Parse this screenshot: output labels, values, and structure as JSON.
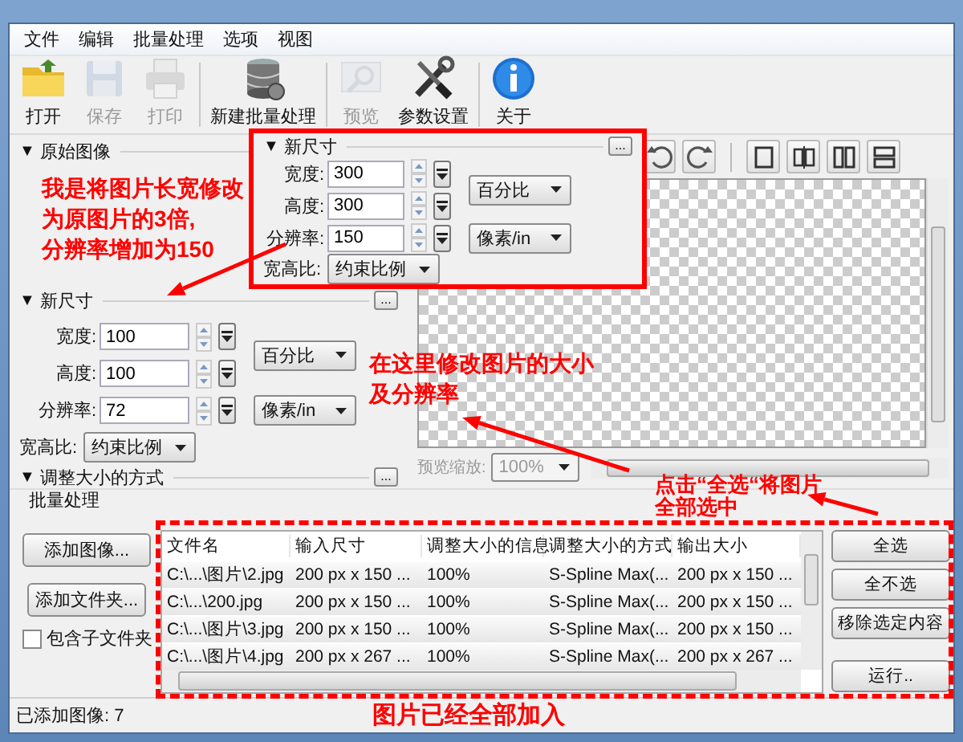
{
  "menu": [
    {
      "label": "文件"
    },
    {
      "label": "编辑"
    },
    {
      "label": "批量处理"
    },
    {
      "label": "选项"
    },
    {
      "label": "视图"
    }
  ],
  "toolbar": [
    {
      "label": "打开",
      "disabled": false
    },
    {
      "label": "保存",
      "disabled": true
    },
    {
      "label": "打印",
      "disabled": true
    },
    {
      "label": "新建批量处理",
      "disabled": false
    },
    {
      "label": "预览",
      "disabled": true
    },
    {
      "label": "参数设置",
      "disabled": false
    },
    {
      "label": "关于",
      "disabled": false
    }
  ],
  "original_image": {
    "toggle": "▼",
    "title": "原始图像"
  },
  "new_size": {
    "toggle": "▼",
    "title": "新尺寸",
    "more": "...",
    "width": {
      "label": "宽度:",
      "value": "100"
    },
    "height": {
      "label": "高度:",
      "value": "100"
    },
    "resolution": {
      "label": "分辨率:",
      "value": "72"
    },
    "size_unit": "百分比",
    "res_unit": "像素/in",
    "aspect": {
      "label": "宽高比:",
      "value": "约束比例"
    }
  },
  "resize_method": {
    "toggle": "▼",
    "title": "调整大小的方式",
    "more": "..."
  },
  "preview": {
    "zoom_label": "预览缩放:",
    "zoom_value": "100%",
    "zoom_disabled": true
  },
  "batch": {
    "title": "批量处理",
    "add_buttons": [
      "添加图像...",
      "添加文件夹..."
    ],
    "include_subfolders": {
      "label": "包含子文件夹",
      "checked": false
    },
    "table": {
      "columns": [
        "文件名",
        "输入尺寸",
        "调整大小的信息",
        "调整大小的方式",
        "输出大小"
      ],
      "rows": [
        [
          "C:\\...\\图片\\2.jpg",
          "200 px x 150 ...",
          "100%",
          "S-Spline Max(...",
          "200 px x 150 ..."
        ],
        [
          "C:\\...\\200.jpg",
          "200 px x 150 ...",
          "100%",
          "S-Spline Max(...",
          "200 px x 150 ..."
        ],
        [
          "C:\\...\\图片\\3.jpg",
          "200 px x 150 ...",
          "100%",
          "S-Spline Max(...",
          "200 px x 150 ..."
        ],
        [
          "C:\\...\\图片\\4.jpg",
          "200 px x 267 ...",
          "100%",
          "S-Spline Max(...",
          "200 px x 267 ..."
        ]
      ]
    },
    "action_buttons": [
      "全选",
      "全不选",
      "移除选定内容",
      "运行.."
    ]
  },
  "status_bar": "已添加图像: 7",
  "annotations": {
    "inset": {
      "toggle": "▼",
      "title": "新尺寸",
      "more": "...",
      "width": {
        "label": "宽度:",
        "value": "300"
      },
      "height": {
        "label": "高度:",
        "value": "300"
      },
      "resolution": {
        "label": "分辨率:",
        "value": "150"
      },
      "size_unit": "百分比",
      "res_unit": "像素/in",
      "aspect": {
        "label": "宽高比:",
        "value": "约束比例"
      }
    },
    "notes": [
      {
        "lines": [
          "我是将图片长宽修改",
          "为原图片的3倍,",
          "分辨率增加为150"
        ]
      },
      {
        "lines": [
          "在这里修改图片的大小",
          "及分辨率"
        ]
      },
      {
        "lines": [
          "点击“全选“将图片",
          "全部选中"
        ]
      },
      {
        "lines": [
          "图片已经全部加入"
        ]
      }
    ]
  }
}
